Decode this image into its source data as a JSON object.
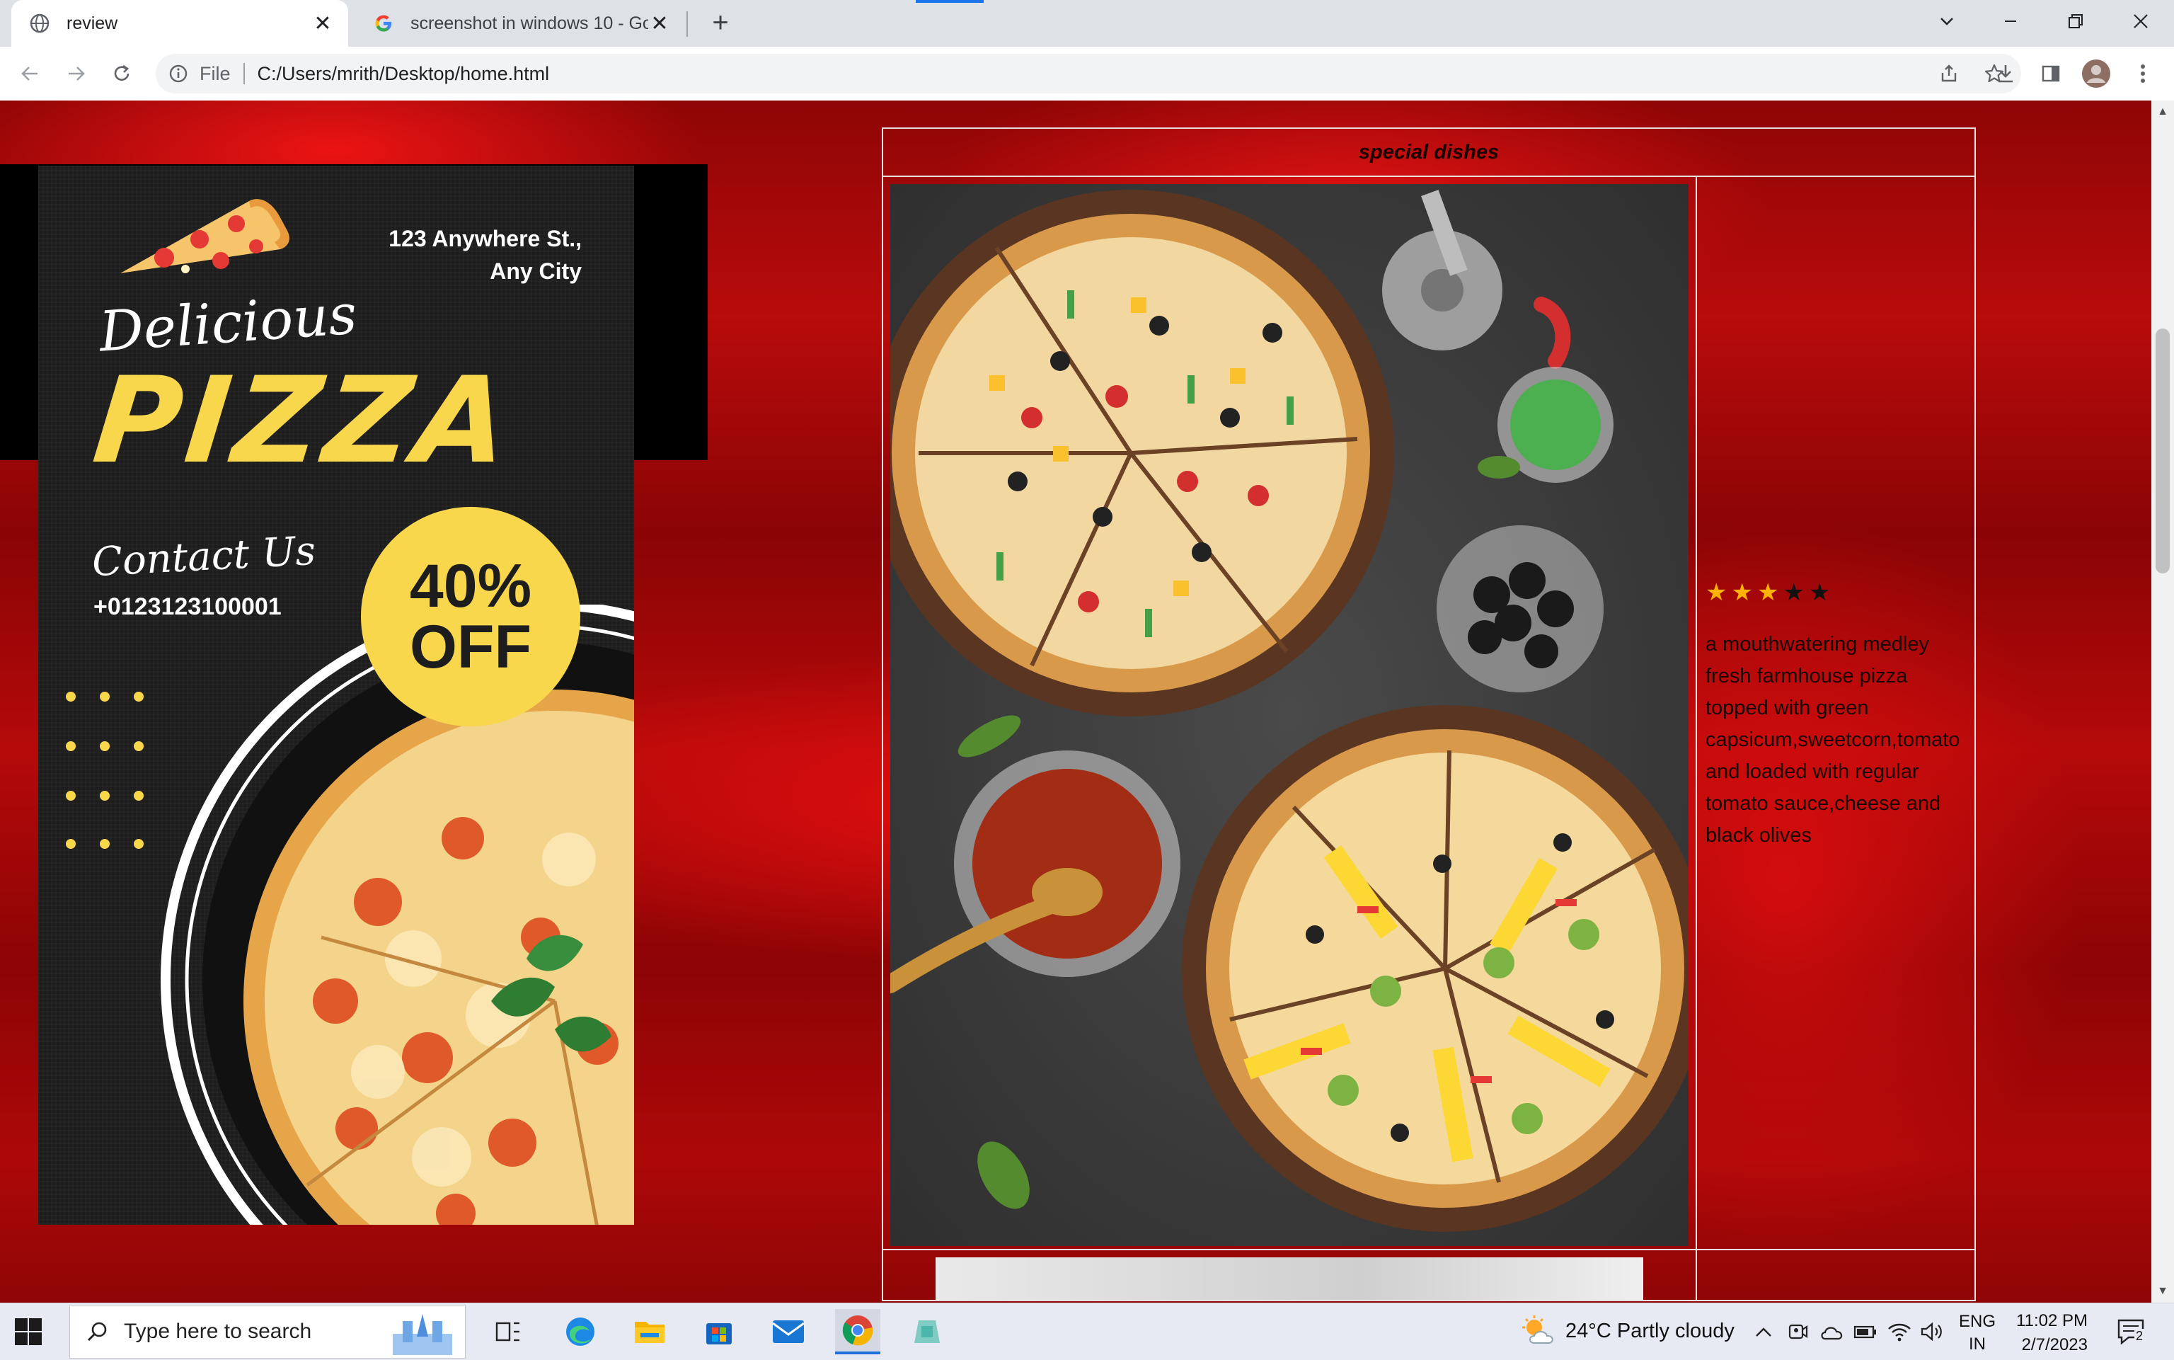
{
  "browser": {
    "tabs": [
      {
        "title": "review",
        "active": true,
        "favicon": "globe-icon"
      },
      {
        "title": "screenshot in windows 10 - Goog",
        "active": false,
        "favicon": "google-icon"
      }
    ],
    "address": {
      "scheme_label": "File",
      "url": "C:/Users/mrith/Desktop/home.html"
    }
  },
  "page": {
    "poster": {
      "address_line1": "123 Anywhere St.,",
      "address_line2": "Any City",
      "tagline": "Delicious",
      "headline": "PIZZA",
      "contact_label": "Contact Us",
      "phone": "+0123123100001",
      "discount_line1": "40%",
      "discount_line2": "OFF"
    },
    "table": {
      "header": "special dishes",
      "dish": {
        "rating": 3,
        "rating_max": 5,
        "description": "a mouthwatering medley fresh farmhouse pizza topped with green capsicum,sweetcorn,tomato and loaded with regular tomato sauce,cheese and black olives"
      }
    }
  },
  "taskbar": {
    "search_placeholder": "Type here to search",
    "weather": "24°C  Partly cloudy",
    "lang_line1": "ENG",
    "lang_line2": "IN",
    "time": "11:02 PM",
    "date": "2/7/2023",
    "notification_count": "2"
  },
  "colors": {
    "accent_yellow": "#f9d74c",
    "page_red": "#b80b0b",
    "star_gold": "#ffb300",
    "chrome_blue": "#1a73e8"
  }
}
